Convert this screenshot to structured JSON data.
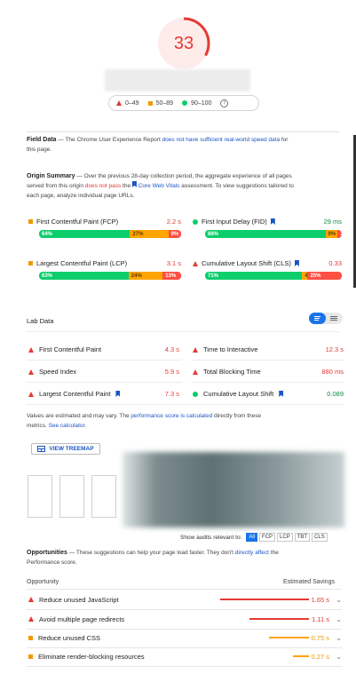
{
  "score": {
    "value": "33",
    "fraction": 0.33,
    "color": "#e53935"
  },
  "legend": {
    "poor": "0–49",
    "average": "50–89",
    "good": "90–100",
    "info_icon": "info-icon"
  },
  "field_data": {
    "title": "Field Data",
    "text_a": "— The Chrome User Experience Report ",
    "link": "does not have sufficient real-world speed data",
    "text_b": " for",
    "text_c": "this page."
  },
  "origin_summary": {
    "title": "Origin Summary",
    "text_a": " — Over the previous 28-day collection period, the aggregate experience of all pages",
    "text_b": "served from this origin ",
    "not_pass": "does not pass",
    "text_c": " the ",
    "cwv": "Core Web Vitals",
    "text_d": " assessment. To view suggestions tailored to",
    "text_e": "each page, analyze individual page URLs."
  },
  "origin_metrics": [
    {
      "label": "First Contentful Paint (FCP)",
      "value": "2.2 s",
      "good": "64%",
      "avg": "27%",
      "poor": "9%",
      "g": 64,
      "a": 27,
      "p": 9
    },
    {
      "label": "First Input Delay (FID)",
      "value": "29 ms",
      "good": "88%",
      "avg": "9%",
      "poor": "2%",
      "g": 88,
      "a": 9,
      "p": 3
    },
    {
      "label": "Largest Contentful Paint (LCP)",
      "value": "3.1 s",
      "good": "63%",
      "avg": "24%",
      "poor": "13%",
      "g": 63,
      "a": 24,
      "p": 13
    },
    {
      "label": "Cumulative Layout Shift (CLS)",
      "value": "0.33",
      "good": "71%",
      "avg": "4%",
      "poor": "25%",
      "g": 71,
      "a": 4,
      "p": 25
    }
  ],
  "lab_data": {
    "title": "Lab Data",
    "metrics": [
      {
        "label": "First Contentful Paint",
        "value": "4.3 s"
      },
      {
        "label": "Time to Interactive",
        "value": "12.3 s"
      },
      {
        "label": "Speed Index",
        "value": "5.9 s"
      },
      {
        "label": "Total Blocking Time",
        "value": "880 ms"
      },
      {
        "label": "Largest Contentful Paint",
        "value": "7.3 s"
      },
      {
        "label": "Cumulative Layout Shift",
        "value": "0.089"
      }
    ]
  },
  "estimate_note": {
    "text_a": "Values are estimated and may vary. The ",
    "link_a": "performance score is calculated",
    "text_b": " directly from these",
    "text_c": "metrics. ",
    "link_b": "See calculator."
  },
  "treemap_button": "VIEW TREEMAP",
  "audits": {
    "label": "Show audits relevant to:",
    "options": [
      "All",
      "FCP",
      "LCP",
      "TBT",
      "CLS"
    ]
  },
  "opportunities": {
    "title": "Opportunities",
    "text_a": " — These suggestions can help your page load faster. They don't ",
    "link": "directly affect",
    "text_b": " the",
    "text_c": "Performance score.",
    "col_opportunity": "Opportunity",
    "col_savings": "Estimated Savings",
    "items": [
      {
        "label": "Reduce unused JavaScript",
        "savings": "1.65 s",
        "fraction": 0.6
      },
      {
        "label": "Avoid multiple page redirects",
        "savings": "1.11 s",
        "fraction": 0.4
      },
      {
        "label": "Reduce unused CSS",
        "savings": "0.75 s",
        "fraction": 0.27
      },
      {
        "label": "Eliminate render-blocking resources",
        "savings": "0.27 s",
        "fraction": 0.11
      }
    ]
  }
}
